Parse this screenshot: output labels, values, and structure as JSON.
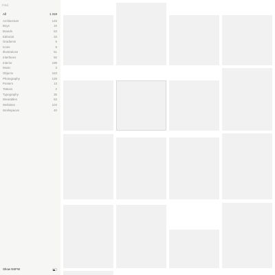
{
  "search": {
    "placeholder": "Find"
  },
  "categories": [
    {
      "label": "All",
      "count": "1 319"
    },
    {
      "label": "Architecture",
      "count": "148"
    },
    {
      "label": "Boys",
      "count": "16"
    },
    {
      "label": "Brands",
      "count": "53"
    },
    {
      "label": "Editorial",
      "count": "33"
    },
    {
      "label": "Gradients",
      "count": "6"
    },
    {
      "label": "Icons",
      "count": "8"
    },
    {
      "label": "Illustrations",
      "count": "51"
    },
    {
      "label": "Interfaces",
      "count": "92"
    },
    {
      "label": "Interior",
      "count": "189"
    },
    {
      "label": "Music",
      "count": "3"
    },
    {
      "label": "Objects",
      "count": "163"
    },
    {
      "label": "Photography",
      "count": "128"
    },
    {
      "label": "Posters",
      "count": "13"
    },
    {
      "label": "Tattoos",
      "count": "2"
    },
    {
      "label": "Typography",
      "count": "35"
    },
    {
      "label": "Wearables",
      "count": "63"
    },
    {
      "label": "Websites",
      "count": "104"
    },
    {
      "label": "Workspaces",
      "count": "40"
    }
  ],
  "footer": {
    "nsfw_label": "Show NSFW",
    "nsfw_enabled": false
  },
  "colors": {
    "sidebar_bg": "#f6f6f4",
    "tile_placeholder": "#f1f1f1"
  }
}
